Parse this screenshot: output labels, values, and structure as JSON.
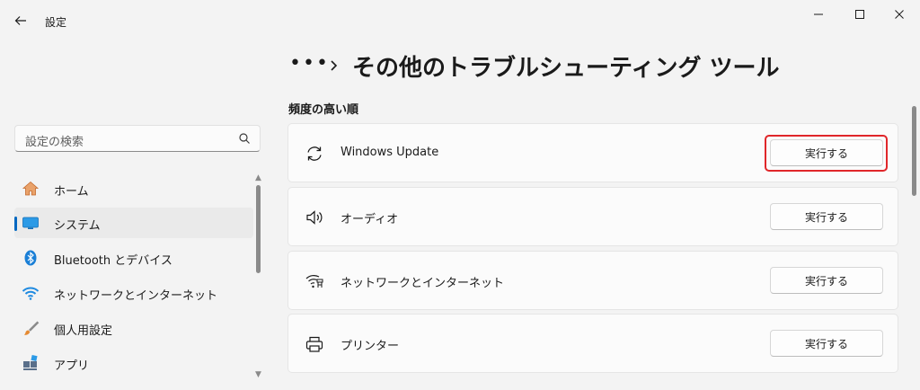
{
  "window": {
    "title": "設定",
    "controls": [
      "minimize",
      "maximize",
      "close"
    ]
  },
  "search": {
    "placeholder": "設定の検索"
  },
  "sidebar": {
    "items": [
      {
        "label": "ホーム",
        "icon": "home-icon",
        "selected": false
      },
      {
        "label": "システム",
        "icon": "system-display-icon",
        "selected": true
      },
      {
        "label": "Bluetooth とデバイス",
        "icon": "bluetooth-icon",
        "selected": false
      },
      {
        "label": "ネットワークとインターネット",
        "icon": "wifi-icon",
        "selected": false
      },
      {
        "label": "個人用設定",
        "icon": "paintbrush-icon",
        "selected": false
      },
      {
        "label": "アプリ",
        "icon": "apps-icon",
        "selected": false
      }
    ]
  },
  "breadcrumb": {
    "ellipsis": "•••",
    "title": "その他のトラブルシューティング ツール"
  },
  "section": {
    "title": "頻度の高い順"
  },
  "troubleshooters": [
    {
      "label": "Windows Update",
      "icon": "sync-icon",
      "button": "実行する",
      "highlighted": true
    },
    {
      "label": "オーディオ",
      "icon": "speaker-icon",
      "button": "実行する",
      "highlighted": false
    },
    {
      "label": "ネットワークとインターネット",
      "icon": "network-icon",
      "button": "実行する",
      "highlighted": false
    },
    {
      "label": "プリンター",
      "icon": "printer-icon",
      "button": "実行する",
      "highlighted": false
    }
  ],
  "colors": {
    "accent": "#0067c0",
    "highlight": "#e0262a",
    "background": "#f3f3f3",
    "card": "#fbfbfb"
  }
}
